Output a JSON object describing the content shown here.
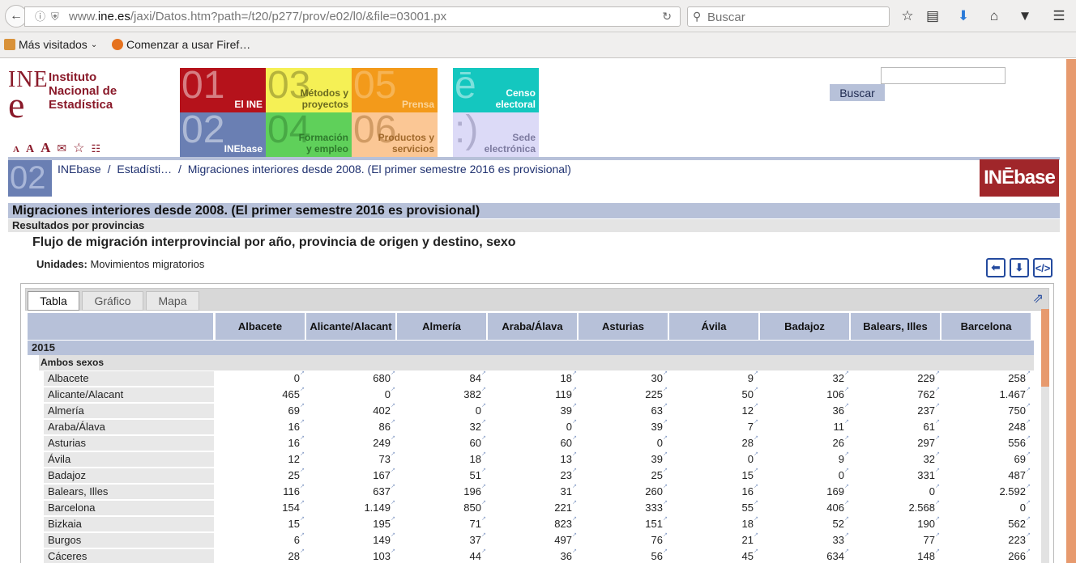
{
  "browser": {
    "url_prefix": "www.",
    "url_domain": "ine.es",
    "url_path": "/jaxi/Datos.htm?path=/t20/p277/prov/e02/l0/&file=03001.px",
    "search_placeholder": "Buscar",
    "bookmarks": [
      "Más visitados",
      "Comenzar a usar Firef…"
    ]
  },
  "header": {
    "logo_line1": "Instituto",
    "logo_line2": "Nacional de",
    "logo_line3": "Estadística",
    "logo_mark_top": "INE",
    "logo_mark_e": "e",
    "tiles": [
      {
        "num": "01",
        "label": "El INE"
      },
      {
        "num": "03",
        "label": "Métodos y proyectos"
      },
      {
        "num": "05",
        "label": "Prensa"
      },
      {
        "num": "ē",
        "label": "Censo electoral"
      },
      {
        "num": "02",
        "label": "INEbase"
      },
      {
        "num": "04",
        "label": "Formación y empleo"
      },
      {
        "num": "06",
        "label": "Productos y servicios"
      },
      {
        "num": ":)",
        "label": "Sede electrónica"
      }
    ],
    "search_button": "Buscar",
    "font_sizes": [
      "A",
      "A",
      "A"
    ]
  },
  "breadcrumb": {
    "tile": "02",
    "items": [
      "INEbase",
      "/",
      "Estadísti…",
      "/",
      "Migraciones interiores desde 2008. (El primer semestre 2016 es provisional)"
    ],
    "logo": "INĒbase"
  },
  "page": {
    "title": "Migraciones interiores desde 2008. (El primer semestre 2016 es provisional)",
    "subtitle": "Resultados por provincias",
    "table_title": "Flujo de migración interprovincial por año, provincia de origen y destino, sexo",
    "units_label": "Unidades:",
    "units_value": "Movimientos migratorios"
  },
  "tabs": [
    "Tabla",
    "Gráfico",
    "Mapa"
  ],
  "table": {
    "columns": [
      "Albacete",
      "Alicante/Alacant",
      "Almería",
      "Araba/Álava",
      "Asturias",
      "Ávila",
      "Badajoz",
      "Balears, Illes",
      "Barcelona"
    ],
    "year": "2015",
    "sex": "Ambos sexos",
    "rows": [
      {
        "label": "Albacete",
        "values": [
          "0",
          "680",
          "84",
          "18",
          "30",
          "9",
          "32",
          "229",
          "258"
        ]
      },
      {
        "label": "Alicante/Alacant",
        "values": [
          "465",
          "0",
          "382",
          "119",
          "225",
          "50",
          "106",
          "762",
          "1.467"
        ]
      },
      {
        "label": "Almería",
        "values": [
          "69",
          "402",
          "0",
          "39",
          "63",
          "12",
          "36",
          "237",
          "750"
        ]
      },
      {
        "label": "Araba/Álava",
        "values": [
          "16",
          "86",
          "32",
          "0",
          "39",
          "7",
          "11",
          "61",
          "248"
        ]
      },
      {
        "label": "Asturias",
        "values": [
          "16",
          "249",
          "60",
          "60",
          "0",
          "28",
          "26",
          "297",
          "556"
        ]
      },
      {
        "label": "Ávila",
        "values": [
          "12",
          "73",
          "18",
          "13",
          "39",
          "0",
          "9",
          "32",
          "69"
        ]
      },
      {
        "label": "Badajoz",
        "values": [
          "25",
          "167",
          "51",
          "23",
          "25",
          "15",
          "0",
          "331",
          "487"
        ]
      },
      {
        "label": "Balears, Illes",
        "values": [
          "116",
          "637",
          "196",
          "31",
          "260",
          "16",
          "169",
          "0",
          "2.592"
        ]
      },
      {
        "label": "Barcelona",
        "values": [
          "154",
          "1.149",
          "850",
          "221",
          "333",
          "55",
          "406",
          "2.568",
          "0"
        ]
      },
      {
        "label": "Bizkaia",
        "values": [
          "15",
          "195",
          "71",
          "823",
          "151",
          "18",
          "52",
          "190",
          "562"
        ]
      },
      {
        "label": "Burgos",
        "values": [
          "6",
          "149",
          "37",
          "497",
          "76",
          "21",
          "33",
          "77",
          "223"
        ]
      },
      {
        "label": "Cáceres",
        "values": [
          "28",
          "103",
          "44",
          "36",
          "56",
          "45",
          "634",
          "148",
          "266"
        ]
      }
    ]
  }
}
